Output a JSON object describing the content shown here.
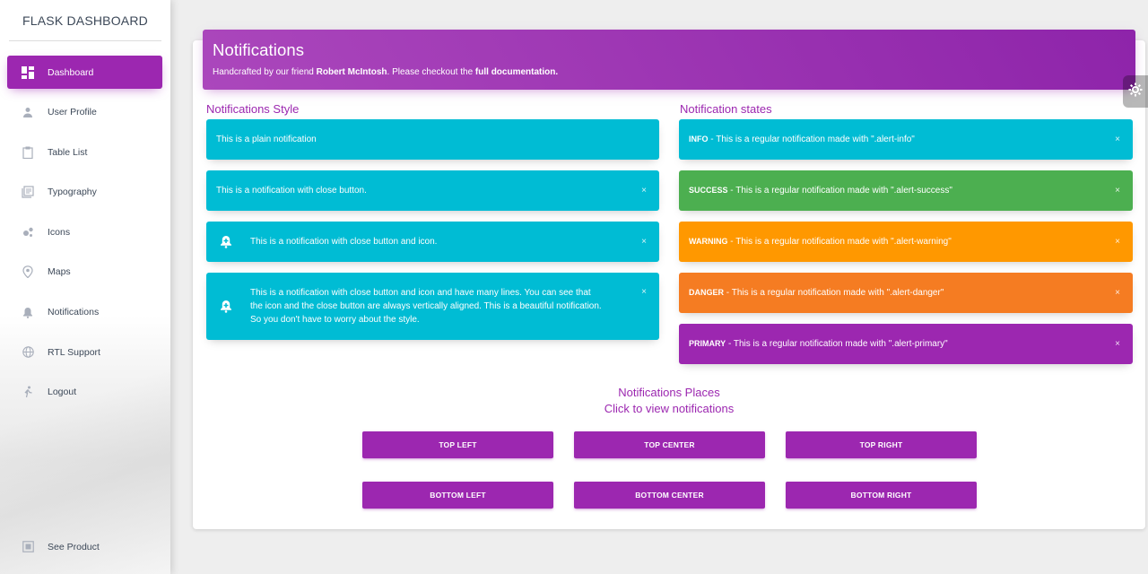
{
  "sidebar": {
    "logo": "FLASK DASHBOARD",
    "items": [
      {
        "label": "Dashboard",
        "icon": "dashboard-icon"
      },
      {
        "label": "User Profile",
        "icon": "person-icon"
      },
      {
        "label": "Table List",
        "icon": "clipboard-icon"
      },
      {
        "label": "Typography",
        "icon": "library-books-icon"
      },
      {
        "label": "Icons",
        "icon": "bubble-chart-icon"
      },
      {
        "label": "Maps",
        "icon": "location-icon"
      },
      {
        "label": "Notifications",
        "icon": "bell-icon"
      },
      {
        "label": "RTL Support",
        "icon": "language-icon"
      },
      {
        "label": "Logout",
        "icon": "logout-icon"
      }
    ],
    "bottom_item": {
      "label": "See Product",
      "icon": "product-icon"
    }
  },
  "header": {
    "title": "Notifications",
    "subtitle_pre": "Handcrafted by our friend ",
    "subtitle_link1": "Robert McIntosh",
    "subtitle_mid": ". Please checkout the ",
    "subtitle_link2": "full documentation."
  },
  "styles_section": {
    "title": "Notifications Style",
    "alerts": [
      {
        "text": "This is a plain notification"
      },
      {
        "text": "This is a notification with close button."
      },
      {
        "text": "This is a notification with close button and icon."
      },
      {
        "text": "This is a notification with close button and icon and have many lines. You can see that the icon and the close button are always vertically aligned. This is a beautiful notification. So you don't have to worry about the style."
      }
    ],
    "close_glyph": "×"
  },
  "states_section": {
    "title": "Notification states",
    "alerts": [
      {
        "state": "INFO",
        "text": " - This is a regular notification made with \".alert-info\""
      },
      {
        "state": "SUCCESS",
        "text": " - This is a regular notification made with \".alert-success\""
      },
      {
        "state": "WARNING",
        "text": " - This is a regular notification made with \".alert-warning\""
      },
      {
        "state": "DANGER",
        "text": " - This is a regular notification made with \".alert-danger\""
      },
      {
        "state": "PRIMARY",
        "text": " - This is a regular notification made with \".alert-primary\""
      }
    ]
  },
  "places": {
    "title": "Notifications Places",
    "subtitle": "Click to view notifications",
    "buttons": [
      "TOP LEFT",
      "TOP CENTER",
      "TOP RIGHT",
      "BOTTOM LEFT",
      "BOTTOM CENTER",
      "BOTTOM RIGHT"
    ]
  },
  "colors": {
    "primary": "#9c27b0",
    "info": "#00bcd4",
    "success": "#4caf50",
    "warning": "#ff9800",
    "danger": "#f57c22"
  }
}
